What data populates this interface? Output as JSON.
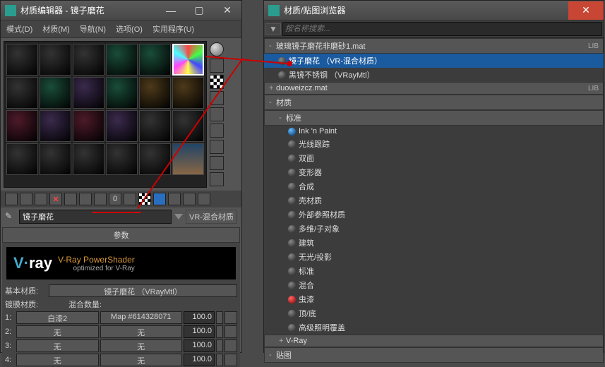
{
  "editor": {
    "title": "材质编辑器 - 镜子磨花",
    "menus": [
      "模式(D)",
      "材质(M)",
      "导航(N)",
      "选项(O)",
      "实用程序(U)"
    ],
    "name_input": "镜子磨花",
    "type_label": "VR-混合材质",
    "rollup_params": "参数",
    "vray": {
      "logo_pre": "V·",
      "logo_post": "ray",
      "line1": "V-Ray PowerShader",
      "line2": "optimized for V-Ray"
    },
    "base_lbl": "基本材质:",
    "base_val": "镜子磨花 （VRayMtl）",
    "coat_hdr1": "镀膜材质:",
    "coat_hdr2": "混合数量:",
    "rows": [
      {
        "i": "1:",
        "a": "白漆2",
        "b": "Map #614328071",
        "n": "100.0"
      },
      {
        "i": "2:",
        "a": "无",
        "b": "无",
        "n": "100.0"
      },
      {
        "i": "3:",
        "a": "无",
        "b": "无",
        "n": "100.0"
      },
      {
        "i": "4:",
        "a": "无",
        "b": "无",
        "n": "100.0"
      }
    ]
  },
  "browser": {
    "title": "材质/贴图浏览器",
    "search_ph": "按名称搜索...",
    "sections": [
      {
        "pm": "-",
        "label": "玻璃镜子磨花非磨砂1.mat",
        "tag": "LIB",
        "items": [
          {
            "label": "镜子磨花 （VR-混合材质）",
            "sel": true
          },
          {
            "label": "黑镜不锈钢 （VRayMtl）"
          }
        ]
      },
      {
        "pm": "+",
        "label": "duoweizcz.mat",
        "tag": "LIB"
      },
      {
        "pm": "-",
        "label": "材质",
        "sub": [
          {
            "pm": "-",
            "label": "标准",
            "items": [
              {
                "label": "Ink 'n Paint",
                "dot": "bl"
              },
              {
                "label": "光线跟踪"
              },
              {
                "label": "双面"
              },
              {
                "label": "变形器"
              },
              {
                "label": "合成"
              },
              {
                "label": "壳材质"
              },
              {
                "label": "外部参照材质"
              },
              {
                "label": "多维/子对象"
              },
              {
                "label": "建筑"
              },
              {
                "label": "无光/投影"
              },
              {
                "label": "标准"
              },
              {
                "label": "混合"
              },
              {
                "label": "虫漆",
                "dot": "rd"
              },
              {
                "label": "顶/底"
              },
              {
                "label": "高级照明覆盖"
              }
            ]
          },
          {
            "pm": "+",
            "label": "V-Ray"
          }
        ]
      },
      {
        "pm": "-",
        "label": "贴图"
      }
    ]
  }
}
